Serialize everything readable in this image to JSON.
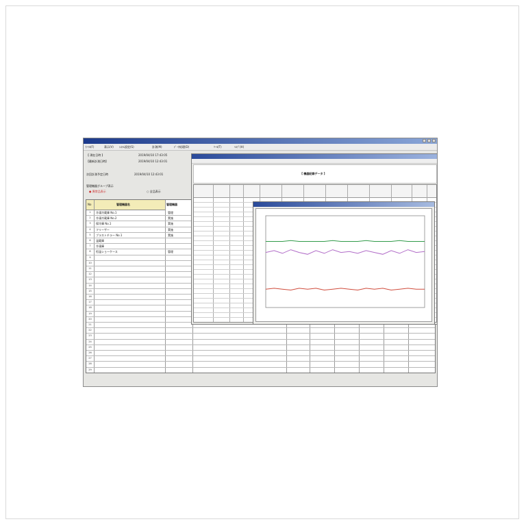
{
  "window": {
    "menu": [
      "ﾌｧｲﾙ(F)",
      "表示(V)",
      "ｼｽﾃﾑ設定(S)",
      "計測(M)",
      "ﾃﾞｰﾀ処理(D)",
      "ﾂｰﾙ(T)",
      "ﾍﾙﾌﾟ(H)"
    ]
  },
  "header": {
    "current_time_label": "【 現在日時 】",
    "current_time_value": "2019/04/10 17:43:05",
    "last_measure_label": "【最新計測日時】",
    "last_measure_value": "2019/04/10 12:43:01",
    "next_label": "次回計測予定日時",
    "next_value": "2019/04/10 12:43:01",
    "group_label": "管理機器グループ表示",
    "radio_1": "異常品表示",
    "radio_2": "全品表示"
  },
  "table": {
    "col_no": "No",
    "col_name": "管理機器名",
    "col_status": "管理機器",
    "rows": [
      {
        "no": "1",
        "name": "冷凍冷蔵庫 No.1",
        "status": "管理"
      },
      {
        "no": "2",
        "name": "冷凍冷蔵庫 No.2",
        "status": "実施"
      },
      {
        "no": "3",
        "name": "保冷庫 No.1",
        "status": "実施"
      },
      {
        "no": "4",
        "name": "フリーザー",
        "status": "実施"
      },
      {
        "no": "5",
        "name": "ブラストチラー No.1",
        "status": "実施"
      },
      {
        "no": "6",
        "name": "温蔵庫",
        "status": ""
      },
      {
        "no": "7",
        "name": "冷凍庫",
        "status": ""
      },
      {
        "no": "8",
        "name": "恒温ショーケース",
        "status": "管理"
      }
    ]
  },
  "detail": {
    "title": "【 機器記録データ 】"
  },
  "chart_data": {
    "type": "line",
    "series": [
      {
        "color": "#2f9a48",
        "values": [
          0.28,
          0.28,
          0.28,
          0.27,
          0.28,
          0.28,
          0.28,
          0.28,
          0.27,
          0.28,
          0.28,
          0.28,
          0.27,
          0.28,
          0.28,
          0.28,
          0.27,
          0.28,
          0.28,
          0.28
        ]
      },
      {
        "color": "#b06ac7",
        "values": [
          0.4,
          0.38,
          0.41,
          0.37,
          0.4,
          0.42,
          0.38,
          0.41,
          0.37,
          0.4,
          0.39,
          0.41,
          0.38,
          0.4,
          0.42,
          0.38,
          0.41,
          0.37,
          0.4,
          0.39
        ]
      },
      {
        "color": "#cf4a3a",
        "values": [
          0.8,
          0.79,
          0.8,
          0.81,
          0.79,
          0.8,
          0.79,
          0.81,
          0.8,
          0.79,
          0.8,
          0.81,
          0.79,
          0.8,
          0.79,
          0.81,
          0.8,
          0.79,
          0.8,
          0.8
        ]
      }
    ]
  }
}
